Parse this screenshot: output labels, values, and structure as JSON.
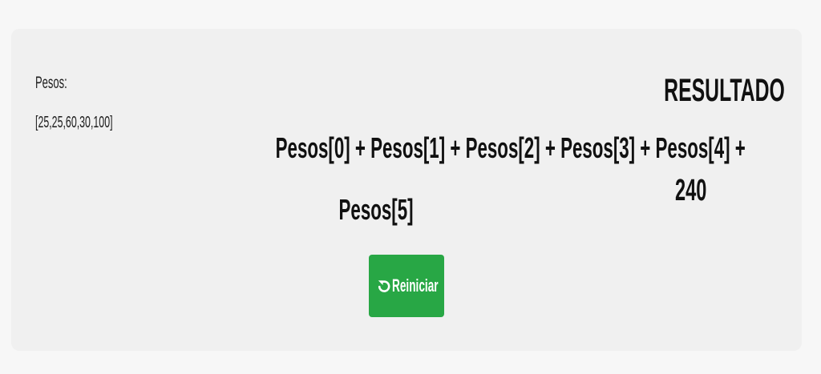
{
  "pesos": {
    "label": "Pesos:",
    "values": "[25,25,60,30,100]"
  },
  "formula": {
    "line1": "Pesos[0] + Pesos[1] + Pesos[2] + Pesos[3] + Pesos[4] +",
    "line2": "Pesos[5]"
  },
  "result": {
    "title": "RESULTADO",
    "value": "240"
  },
  "reset_button": {
    "label": "Reiniciar",
    "icon": "undo-icon",
    "color": "#28a745"
  },
  "colors": {
    "card_background": "#f0f0f0",
    "page_background": "#f7f7f7"
  }
}
